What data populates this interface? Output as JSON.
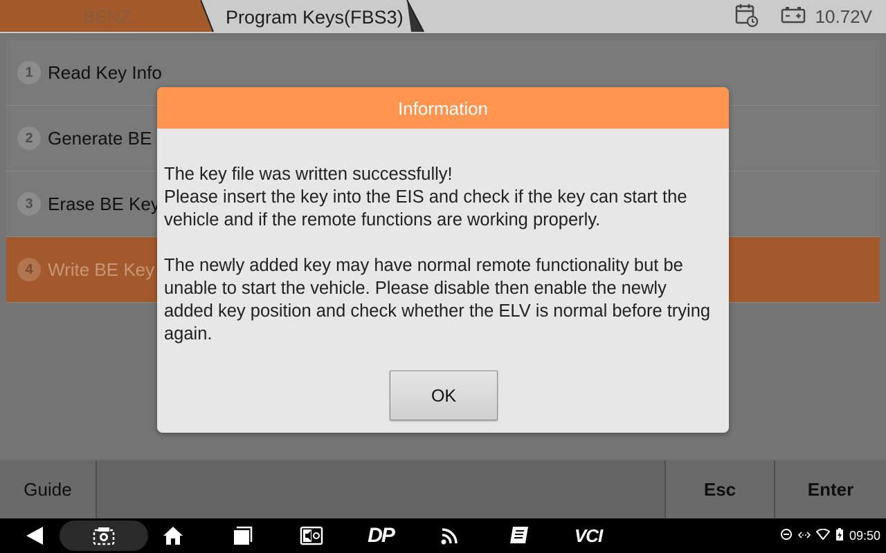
{
  "header": {
    "brand_tab": "BENZ",
    "function_tab": "Program Keys(FBS3)",
    "voltage": "10.72V",
    "icons": [
      "calendar-clock-icon",
      "battery-icon"
    ]
  },
  "menu": {
    "items": [
      {
        "num": "1",
        "label": "Read Key Info"
      },
      {
        "num": "2",
        "label": "Generate BE K"
      },
      {
        "num": "3",
        "label": "Erase BE Key I"
      },
      {
        "num": "4",
        "label": "Write BE Key D"
      }
    ],
    "selected_index": 3
  },
  "bottom_bar": {
    "guide": "Guide",
    "esc": "Esc",
    "enter": "Enter"
  },
  "dialog": {
    "title": "Information",
    "line1": "The key file was written successfully!",
    "line2": "Please insert the key into the EIS and check if the key can start the vehicle and if the remote functions are working properly.",
    "line3": "The newly added key may have normal remote functionality but be unable to start the vehicle. Please disable then enable the newly added key position and check whether the ELV is normal before trying again.",
    "ok": "OK"
  },
  "navbar": {
    "icons": [
      "back-icon",
      "screenshot-icon",
      "home-icon",
      "recents-icon",
      "display-icon",
      "dp-icon",
      "wireless-icon",
      "manual-icon",
      "vci-icon"
    ],
    "dp_text": "DP",
    "vci_text": "VCI",
    "time": "09:50"
  },
  "colors": {
    "accent": "#ff9551",
    "active_row": "#a25a2c",
    "dialog_bg": "#e7e7e7"
  }
}
